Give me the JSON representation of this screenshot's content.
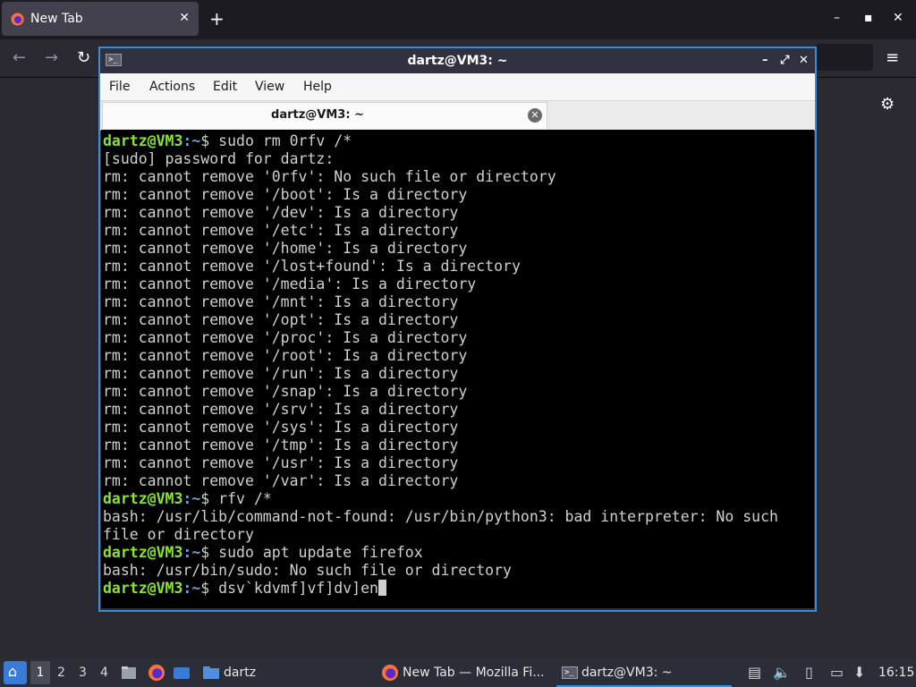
{
  "browser": {
    "tab_title": "New Tab",
    "tab_close": "✕",
    "new_tab": "+",
    "win_min": "–",
    "win_max": "▪",
    "win_close": "✕",
    "back": "←",
    "forward": "→",
    "reload": "↻",
    "menu": "≡",
    "settings": "⚙"
  },
  "terminal": {
    "window_title": "dartz@VM3: ~",
    "controls": {
      "minimize": "–",
      "maximize": "⤢",
      "close": "✕"
    },
    "menu": [
      "File",
      "Actions",
      "Edit",
      "View",
      "Help"
    ],
    "tab_title": "dartz@VM3: ~",
    "tab_close": "✕",
    "prompt_user": "dartz@VM3",
    "prompt_path": ":~",
    "prompt_symbol": "$ ",
    "lines": [
      {
        "prompt": true,
        "text": "sudo rm 0rfv /*"
      },
      {
        "text": "[sudo] password for dartz:"
      },
      {
        "text": "rm: cannot remove '0rfv': No such file or directory"
      },
      {
        "text": "rm: cannot remove '/boot': Is a directory"
      },
      {
        "text": "rm: cannot remove '/dev': Is a directory"
      },
      {
        "text": "rm: cannot remove '/etc': Is a directory"
      },
      {
        "text": "rm: cannot remove '/home': Is a directory"
      },
      {
        "text": "rm: cannot remove '/lost+found': Is a directory"
      },
      {
        "text": "rm: cannot remove '/media': Is a directory"
      },
      {
        "text": "rm: cannot remove '/mnt': Is a directory"
      },
      {
        "text": "rm: cannot remove '/opt': Is a directory"
      },
      {
        "text": "rm: cannot remove '/proc': Is a directory"
      },
      {
        "text": "rm: cannot remove '/root': Is a directory"
      },
      {
        "text": "rm: cannot remove '/run': Is a directory"
      },
      {
        "text": "rm: cannot remove '/snap': Is a directory"
      },
      {
        "text": "rm: cannot remove '/srv': Is a directory"
      },
      {
        "text": "rm: cannot remove '/sys': Is a directory"
      },
      {
        "text": "rm: cannot remove '/tmp': Is a directory"
      },
      {
        "text": "rm: cannot remove '/usr': Is a directory"
      },
      {
        "text": "rm: cannot remove '/var': Is a directory"
      },
      {
        "prompt": true,
        "text": "rfv /*"
      },
      {
        "text": "bash: /usr/lib/command-not-found: /usr/bin/python3: bad interpreter: No such"
      },
      {
        "text": "file or directory"
      },
      {
        "prompt": true,
        "text": "sudo apt update firefox"
      },
      {
        "text": "bash: /usr/bin/sudo: No such file or directory"
      },
      {
        "prompt": true,
        "text": "dsv`kdvmf]vf]dv]en",
        "cursor": true
      }
    ]
  },
  "taskbar": {
    "workspaces": [
      "1",
      "2",
      "3",
      "4"
    ],
    "folder_label": "dartz",
    "tasks": [
      {
        "label": "New Tab — Mozilla Fi..."
      },
      {
        "label": "dartz@VM3: ~"
      }
    ],
    "clock": "16:15"
  }
}
